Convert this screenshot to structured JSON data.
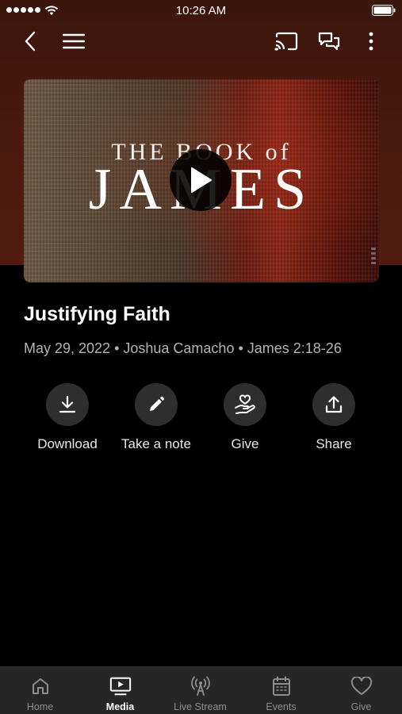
{
  "status_bar": {
    "time": "10:26 AM"
  },
  "artwork": {
    "line1": "THE BOOK of",
    "line2": "JAMES"
  },
  "sermon": {
    "title": "Justifying Faith",
    "meta": "May 29, 2022 • Joshua Camacho • James 2:18-26"
  },
  "actions": [
    {
      "label": "Download",
      "icon": "download-icon"
    },
    {
      "label": "Take a note",
      "icon": "pencil-icon"
    },
    {
      "label": "Give",
      "icon": "hand-heart-icon"
    },
    {
      "label": "Share",
      "icon": "share-icon"
    }
  ],
  "tabs": [
    {
      "label": "Home",
      "icon": "home-icon",
      "active": false
    },
    {
      "label": "Media",
      "icon": "media-icon",
      "active": true
    },
    {
      "label": "Live Stream",
      "icon": "broadcast-icon",
      "active": false
    },
    {
      "label": "Events",
      "icon": "calendar-icon",
      "active": false
    },
    {
      "label": "Give",
      "icon": "heart-icon",
      "active": false
    }
  ],
  "colors": {
    "background": "#000000",
    "hero": "#4a1a0e",
    "tab_bar": "#262626",
    "action_circle": "#2e2e2e",
    "meta_text": "#b3b3b3"
  }
}
